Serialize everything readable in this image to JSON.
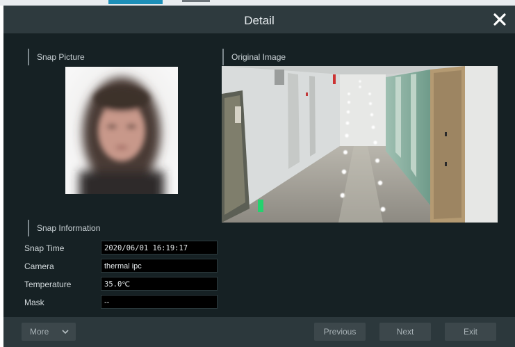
{
  "dialog": {
    "title": "Detail",
    "close_icon": "close-icon"
  },
  "snap_picture": {
    "label": "Snap Picture"
  },
  "original_image": {
    "label": "Original Image"
  },
  "snap_information": {
    "label": "Snap Information",
    "rows": [
      {
        "label": "Snap Time",
        "value": "2020/06/01 16:19:17"
      },
      {
        "label": "Camera",
        "value": "thermal ipc"
      },
      {
        "label": "Temperature",
        "value": "35.0℃"
      },
      {
        "label": "Mask",
        "value": "--"
      }
    ]
  },
  "footer": {
    "more_label": "More",
    "previous_label": "Previous",
    "next_label": "Next",
    "exit_label": "Exit"
  },
  "colors": {
    "dialog_bg": "#162124",
    "title_bar_bg": "#2e3a3e",
    "footer_bg": "#2c383c",
    "button_bg": "#3c474b",
    "accent_tab": "#1d8fb8"
  }
}
